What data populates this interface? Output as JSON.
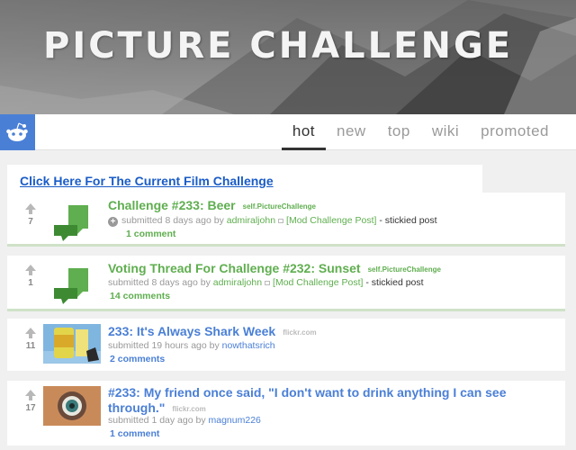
{
  "banner": {
    "title": "PICTURE  CHALLENGE"
  },
  "nav": {
    "logo": "reddit-alien-icon",
    "tabs": [
      {
        "label": "hot",
        "active": true
      },
      {
        "label": "new",
        "active": false
      },
      {
        "label": "top",
        "active": false
      },
      {
        "label": "wiki",
        "active": false
      },
      {
        "label": "promoted",
        "active": false
      }
    ]
  },
  "announcement": {
    "link_text": "Click Here For The Current Film Challenge"
  },
  "posts": [
    {
      "score": "7",
      "title": "Challenge #233: Beer",
      "domain": "self.PictureChallenge",
      "submitted": "submitted 8 days ago by",
      "author": "admiraljohn",
      "flair": "[Mod Challenge Post]",
      "sticky": "- stickied post",
      "comments": "1 comment",
      "thumbnail": "self-post-icon"
    },
    {
      "score": "1",
      "title": "Voting Thread For Challenge #232: Sunset",
      "domain": "self.PictureChallenge",
      "submitted": "submitted 8 days ago by",
      "author": "admiraljohn",
      "flair": "[Mod Challenge Post]",
      "sticky": "- stickied post",
      "comments": "14 comments",
      "thumbnail": "self-post-icon"
    },
    {
      "score": "11",
      "title": "233: It's Always Shark Week",
      "domain": "flickr.com",
      "submitted": "submitted 19 hours ago by",
      "author": "nowthatsrich",
      "comments": "2 comments",
      "thumbnail": "beer-bottle-photo"
    },
    {
      "score": "17",
      "title_line1": "#233: My friend once said, \"I don't want to drink anything I can see",
      "title_line2": "through.\"",
      "domain": "flickr.com",
      "submitted": "submitted 1 day ago by",
      "author": "magnum226",
      "comments": "1 comment",
      "thumbnail": "bottle-top-photo"
    }
  ],
  "colors": {
    "accent_blue": "#4a7fd6",
    "sticky_green": "#5fae4f",
    "link_blue": "#1a5cc7"
  }
}
